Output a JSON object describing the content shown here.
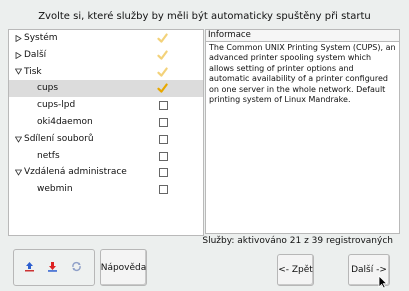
{
  "title": "Zvolte si, které služby by měli být automaticky spuštěny při startu",
  "services": [
    {
      "label": "Systém",
      "kind": "category",
      "expanded": false,
      "state": "partial",
      "selected": false
    },
    {
      "label": "Další",
      "kind": "category",
      "expanded": false,
      "state": "partial",
      "selected": false
    },
    {
      "label": "Tisk",
      "kind": "category",
      "expanded": true,
      "state": "partial",
      "selected": false
    },
    {
      "label": "cups",
      "kind": "item",
      "state": "checked",
      "selected": true
    },
    {
      "label": "cups-lpd",
      "kind": "item",
      "state": "unchecked",
      "selected": false
    },
    {
      "label": "oki4daemon",
      "kind": "item",
      "state": "unchecked",
      "selected": false
    },
    {
      "label": "Sdílení souborů",
      "kind": "category",
      "expanded": true,
      "state": "unchecked",
      "selected": false
    },
    {
      "label": "netfs",
      "kind": "item",
      "state": "unchecked",
      "selected": false
    },
    {
      "label": "Vzdálená administrace",
      "kind": "category",
      "expanded": true,
      "state": "unchecked",
      "selected": false
    },
    {
      "label": "webmin",
      "kind": "item",
      "state": "unchecked",
      "selected": false
    }
  ],
  "info": {
    "heading": "Informace",
    "text": "The Common UNIX Printing System (CUPS), an advanced printer spooling system which allows setting of printer options and automatic availability of a printer configured on one server in the whole network. Default printing system of Linux Mandrake."
  },
  "status": "Služby: aktivováno 21 z 39 registrovaných",
  "buttons": {
    "help": "Nápověda",
    "back": "<- Zpět",
    "next": "Další ->"
  },
  "icons": [
    "install-up-icon",
    "install-down-icon",
    "refresh-icon"
  ],
  "colors": {
    "background": "#ecefee",
    "check_full": "#e8a800",
    "check_partial": "#f3d27a",
    "selected_row": "#dcdcdc"
  }
}
